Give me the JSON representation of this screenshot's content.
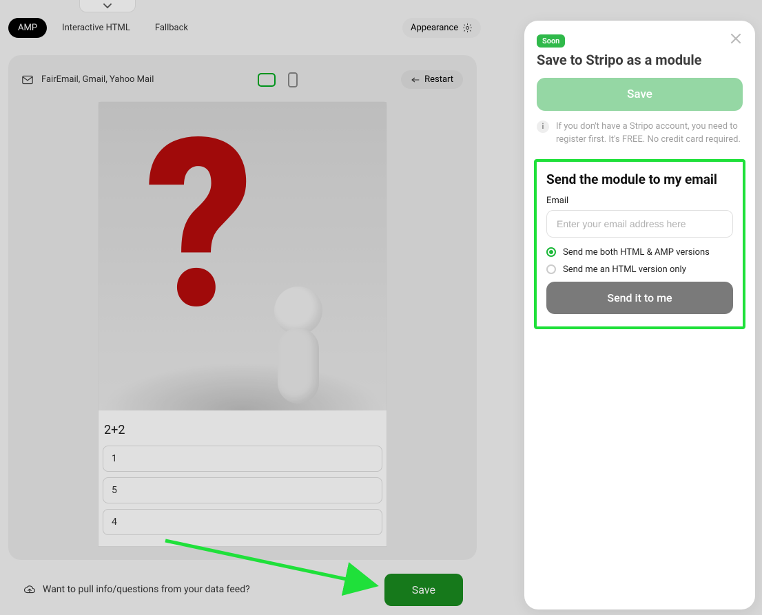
{
  "tabs": {
    "amp": "AMP",
    "interactive": "Interactive HTML",
    "fallback": "Fallback"
  },
  "appearance": "Appearance",
  "preview": {
    "clients": "FairEmail, Gmail, Yahoo Mail",
    "restart": "Restart",
    "question": "2+2",
    "answers": [
      "1",
      "5",
      "4"
    ]
  },
  "bottom": {
    "feedText": "Want to pull info/questions from your data feed?",
    "save": "Save"
  },
  "panel": {
    "soon": "Soon",
    "title": "Save to Stripo as a module",
    "save": "Save",
    "info": "If you don't have a Stripo account, you need to register first. It's FREE. No credit card required.",
    "sendTitle": "Send the module to my email",
    "emailLabel": "Email",
    "emailPlaceholder": "Enter your email address here",
    "optBoth": "Send me both HTML & AMP versions",
    "optHtml": "Send me an HTML version only",
    "sendBtn": "Send it to me"
  }
}
